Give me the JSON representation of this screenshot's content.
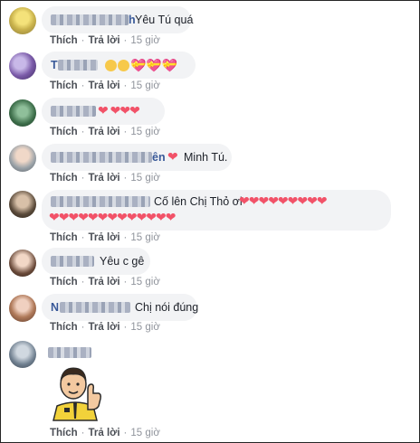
{
  "comments": [
    {
      "name_prefix": "",
      "name_suffix": "h",
      "text": "Yêu Tú quá",
      "like": "Thích",
      "reply": "Trả lời",
      "time": "15 giờ"
    },
    {
      "name_prefix": "T",
      "name_suffix": "",
      "text": "",
      "like": "Thích",
      "reply": "Trả lời",
      "time": "15 giờ"
    },
    {
      "name_prefix": "",
      "name_suffix": "",
      "text": "",
      "like": "Thích",
      "reply": "Trả lời",
      "time": "15 giờ"
    },
    {
      "name_prefix": "",
      "name_suffix": "ên",
      "text": "Minh Tú.",
      "like": "Thích",
      "reply": "Trả lời",
      "time": "15 giờ"
    },
    {
      "name_prefix": "",
      "name_suffix": "",
      "text": "Cố lên Chị Thỏ ơi",
      "like": "Thích",
      "reply": "Trả lời",
      "time": "15 giờ"
    },
    {
      "name_prefix": "",
      "name_suffix": "",
      "text": "Yêu c gê",
      "like": "Thích",
      "reply": "Trả lời",
      "time": "15 giờ"
    },
    {
      "name_prefix": "N",
      "name_suffix": "",
      "text": "Chị nói đúng",
      "like": "Thích",
      "reply": "Trả lời",
      "time": "15 giờ"
    },
    {
      "name_prefix": "",
      "name_suffix": "",
      "text": "",
      "like": "Thích",
      "reply": "Trả lời",
      "time": "15 giờ"
    }
  ],
  "colors": {
    "heart": "#f25268",
    "link": "#4b4f56",
    "meta": "#90949c",
    "bubble": "#f2f3f5"
  }
}
